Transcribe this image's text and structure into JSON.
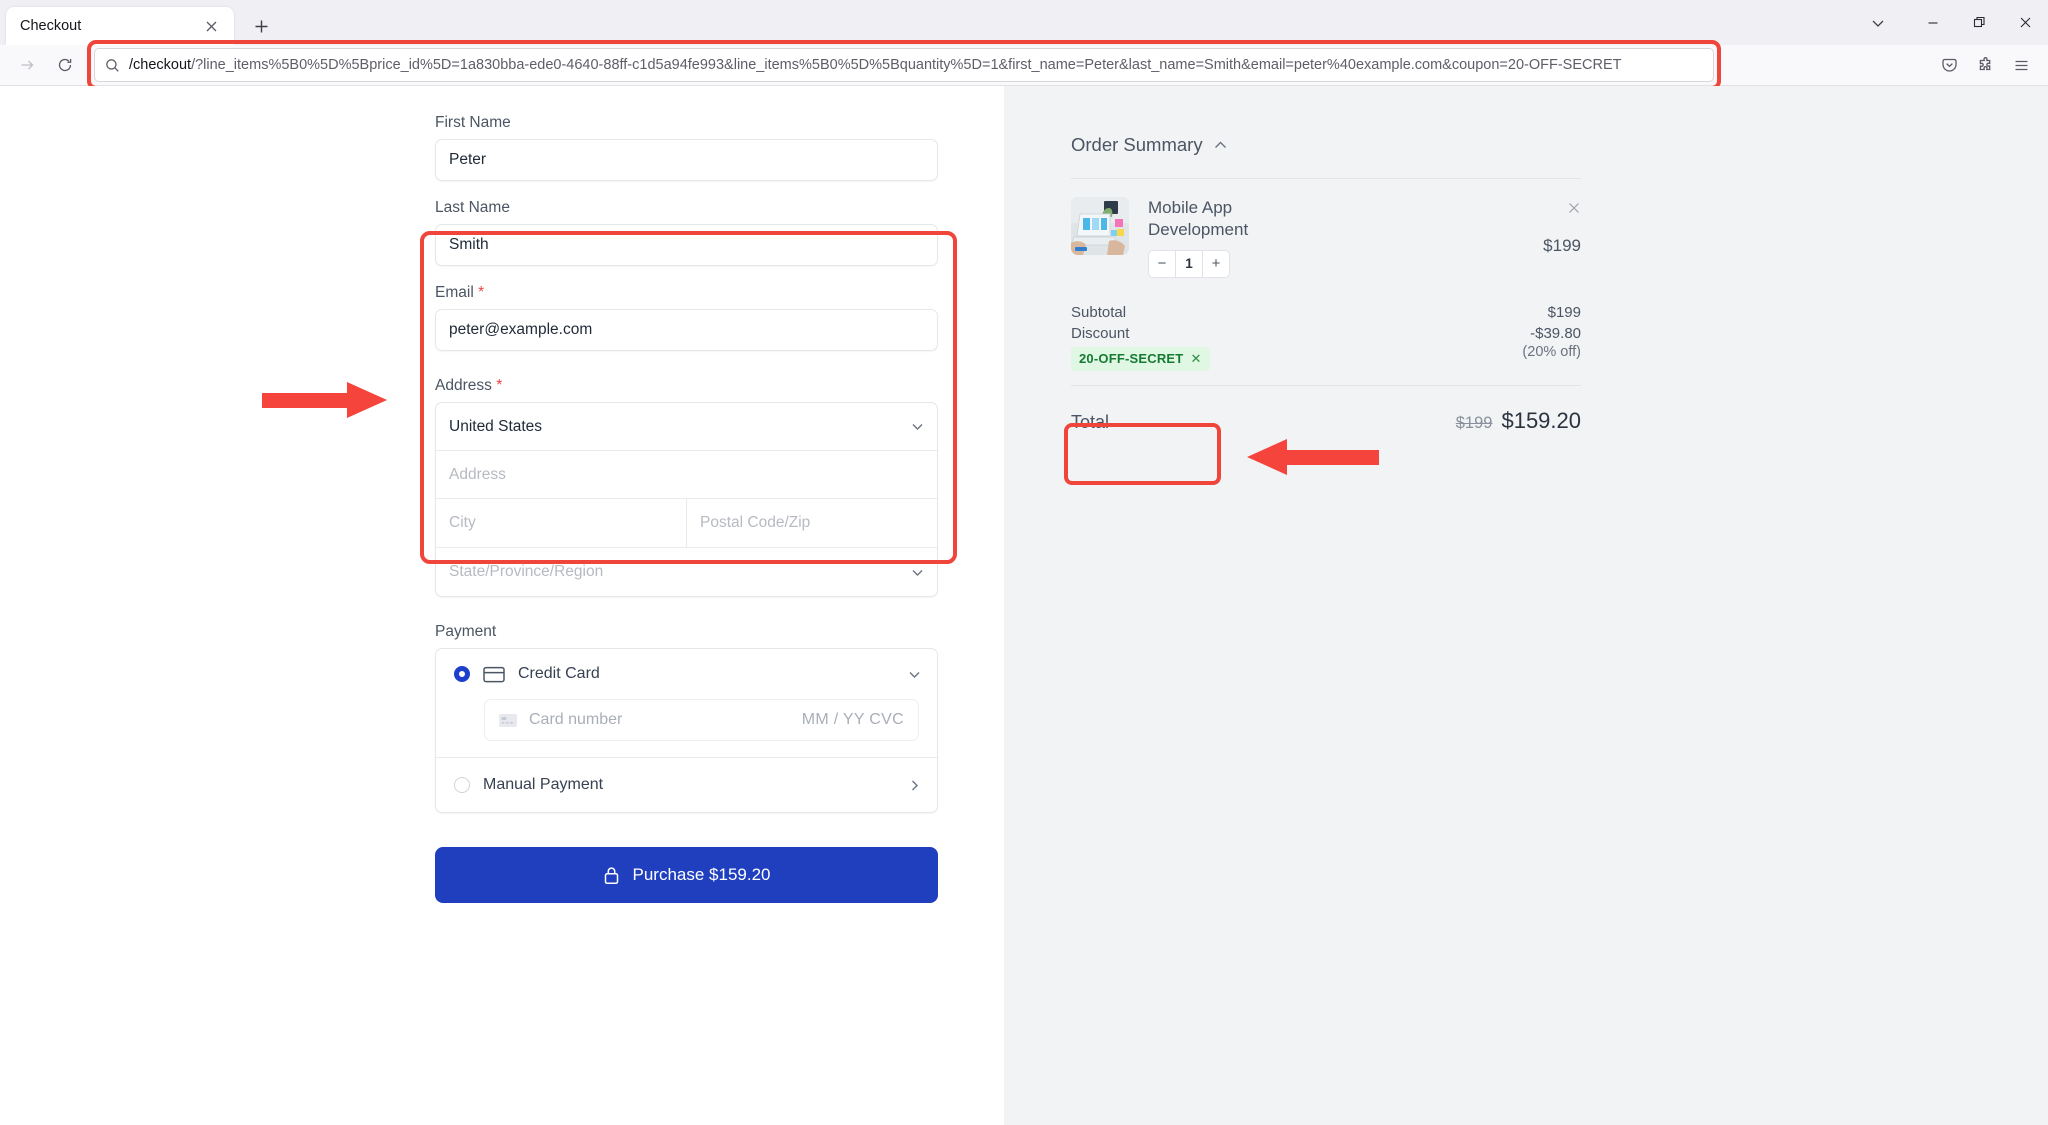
{
  "browser": {
    "tab": {
      "title": "Checkout",
      "close_icon": "close-icon"
    },
    "new_tab_label": "+",
    "window_controls": {
      "minimize": "—",
      "maximize": "❐",
      "close": "✕",
      "list_all_tabs": "⌄"
    },
    "nav": {
      "forward": "→",
      "reload": "⟳"
    },
    "url": {
      "search_icon": "search-icon",
      "host": "/checkout",
      "path": "/?line_items%5B0%5D%5Bprice_id%5D=1a830bba-ede0-4640-88ff-c1d5a94fe993&line_items%5B0%5D%5Bquantity%5D=1&first_name=Peter&last_name=Smith&email=peter%40example.com&coupon=20-OFF-SECRET"
    },
    "toolbar_right": [
      "save-to-pocket-icon",
      "extensions-icon",
      "app-menu-icon"
    ]
  },
  "form": {
    "first_name": {
      "label": "First Name",
      "value": "Peter"
    },
    "last_name": {
      "label": "Last Name",
      "value": "Smith"
    },
    "email": {
      "label": "Email",
      "required": "*",
      "value": "peter@example.com"
    },
    "address": {
      "label": "Address",
      "required": "*",
      "country": "United States",
      "street_placeholder": "Address",
      "city_placeholder": "City",
      "postal_placeholder": "Postal Code/Zip",
      "state_placeholder": "State/Province/Region"
    },
    "payment": {
      "label": "Payment",
      "credit_card": "Credit Card",
      "card_number_placeholder": "Card number",
      "card_meta_placeholder": "MM / YY  CVC",
      "manual_payment": "Manual Payment"
    },
    "purchase_button": "Purchase $159.20",
    "lock_icon": "lock-icon"
  },
  "summary": {
    "title": "Order Summary",
    "collapse_icon": "chevron-up-icon",
    "item": {
      "name": "Mobile App Development",
      "price": "$199",
      "quantity": "1",
      "decrease": "−",
      "increase": "+",
      "remove_icon": "close-icon"
    },
    "subtotal": {
      "label": "Subtotal",
      "value": "$199"
    },
    "discount": {
      "label": "Discount",
      "value": "-$39.80",
      "percent": "(20% off)",
      "coupon_code": "20-OFF-SECRET",
      "coupon_remove": "✕"
    },
    "total": {
      "label": "Total",
      "original": "$199",
      "value": "$159.20"
    }
  },
  "annotations": {
    "accent_red": "#f0453a",
    "arrow_form": "arrow-pointing-to-customer-fields",
    "arrow_discount": "arrow-pointing-to-discount-coupon"
  }
}
